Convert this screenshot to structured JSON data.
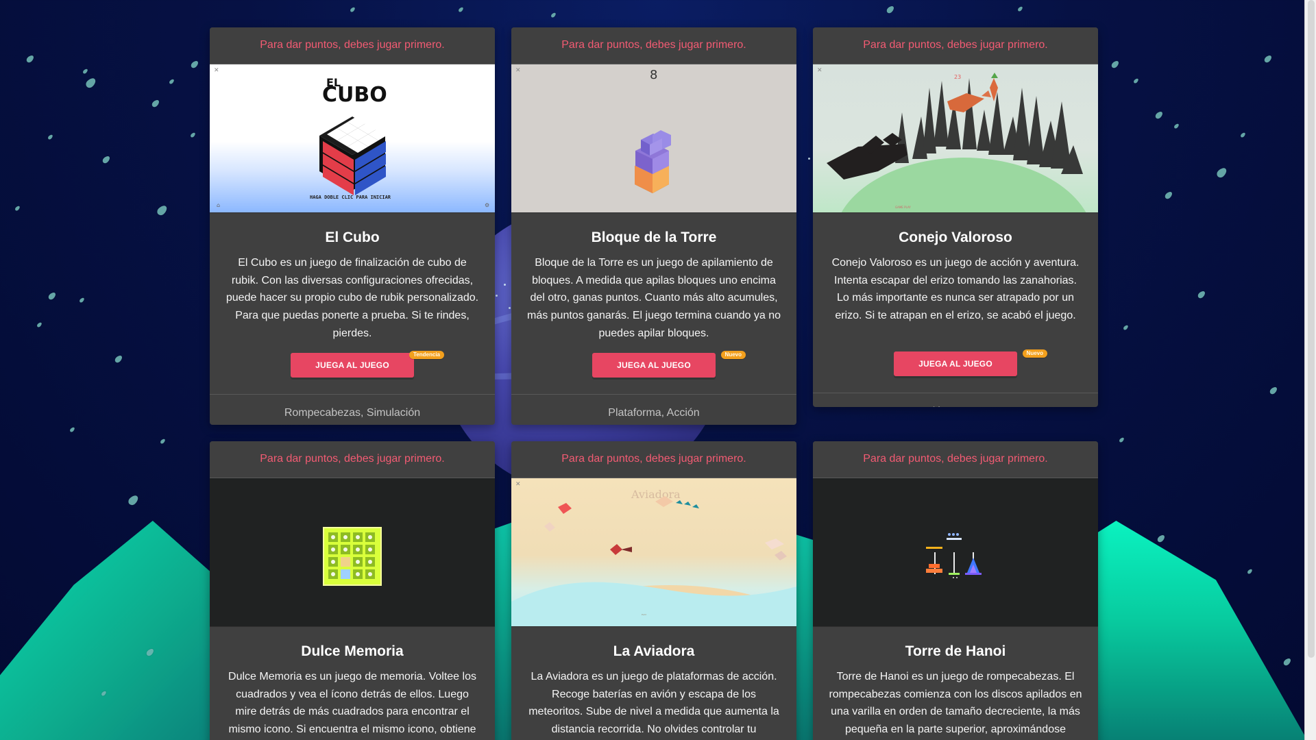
{
  "page": {
    "background": {
      "colors": {
        "sky": "#061144",
        "mountain": "#12ac93",
        "accent": "#e74662",
        "notice": "#f35b73",
        "badge": "#f3a01d"
      }
    }
  },
  "cards": [
    {
      "notice": "Para dar puntos, debes jugar primero.",
      "title": "El Cubo",
      "description": "El Cubo es un juego de finalización de cubo de rubik. Con las diversas configuraciones ofrecidas, puede hacer su propio cubo de rubik personalizado. Para que puedas ponerte a prueba. Si te rindes, pierdes.",
      "button_label": "JUEGA AL JUEGO",
      "badge": "Tendencia",
      "tags": "Rompecabezas, Simulación",
      "preview": {
        "heading_small": "EL",
        "heading_large": "CUBO",
        "footer_text": "HAGA DOBLE CLIC PARA INICIAR"
      }
    },
    {
      "notice": "Para dar puntos, debes jugar primero.",
      "title": "Bloque de la Torre",
      "description": "Bloque de la Torre es un juego de apilamiento de bloques. A medida que apilas bloques uno encima del otro, ganas puntos. Cuanto más alto acumules, más puntos ganarás. El juego termina cuando ya no puedes apilar bloques.",
      "button_label": "JUEGA AL JUEGO",
      "badge": "Nuevo",
      "tags": "Plataforma, Acción",
      "preview": {
        "score": "8"
      }
    },
    {
      "notice": "Para dar puntos, debes jugar primero.",
      "title": "Conejo Valoroso",
      "description": "Conejo Valoroso es un juego de acción y aventura. Intenta escapar del erizo tomando las zanahorias. Lo más importante es nunca ser atrapado por un erizo. Si te atrapan en el erizo, se acabó el juego.",
      "button_label": "JUEGA AL JUEGO",
      "badge": "Nuevo",
      "tags": "Acción, Aventura",
      "preview": {
        "score": "23"
      }
    },
    {
      "notice": "Para dar puntos, debes jugar primero.",
      "title": "Dulce Memoria",
      "description": "Dulce Memoria es un juego de memoria. Voltee los cuadrados y vea el ícono detrás de ellos. Luego mire detrás de más cuadrados para encontrar el mismo icono. Si encuentra el mismo icono, obtiene",
      "button_label": "JUEGA AL JUEGO",
      "badge": "",
      "tags": "",
      "preview": {}
    },
    {
      "notice": "Para dar puntos, debes jugar primero.",
      "title": "La Aviadora",
      "description": "La Aviadora es un juego de plataformas de acción. Recoge baterías en avión y escapa de los meteoritos. Sube de nivel a medida que aumenta la distancia recorrida. No olvides controlar tu",
      "button_label": "JUEGA AL JUEGO",
      "badge": "",
      "tags": "",
      "preview": {
        "logo": "Aviadora"
      }
    },
    {
      "notice": "Para dar puntos, debes jugar primero.",
      "title": "Torre de Hanoi",
      "description": "Torre de Hanoi es un juego de rompecabezas. El rompecabezas comienza con los discos apilados en una varilla en orden de tamaño decreciente, la más pequeña en la parte superior, aproximándose",
      "button_label": "JUEGA AL JUEGO",
      "badge": "",
      "tags": "",
      "preview": {}
    }
  ]
}
